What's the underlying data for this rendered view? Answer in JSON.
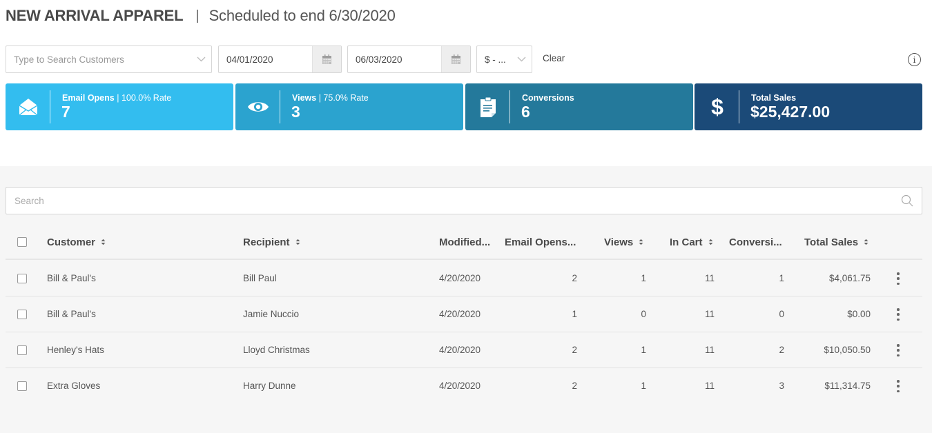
{
  "header": {
    "title": "NEW ARRIVAL APPAREL",
    "separator": "|",
    "subtitle": "Scheduled to end 6/30/2020"
  },
  "filters": {
    "customer_select": {
      "placeholder": "Type to Search Customers",
      "icon": "chevron-down-icon"
    },
    "start_date": {
      "value": "04/01/2020",
      "icon": "calendar-icon"
    },
    "end_date": {
      "value": "06/03/2020",
      "icon": "calendar-icon"
    },
    "currency_select": {
      "value": "$ - ...",
      "icon": "chevron-down-icon"
    },
    "clear_label": "Clear",
    "info_icon": "info-icon",
    "info_glyph": "i"
  },
  "cards": [
    {
      "name": "email-opens",
      "label": "Email Opens",
      "sep": " | ",
      "rate": "100.0% Rate",
      "value": "7",
      "icon": "envelope-open-icon",
      "color": "#33bdef"
    },
    {
      "name": "views",
      "label": "Views",
      "sep": " | ",
      "rate": "75.0% Rate",
      "value": "3",
      "icon": "eye-icon",
      "color": "#2ba3cf"
    },
    {
      "name": "conversions",
      "label": "Conversions",
      "sep": "",
      "rate": "",
      "value": "6",
      "icon": "clipboard-icon",
      "color": "#24799b"
    },
    {
      "name": "total-sales",
      "label": "Total Sales",
      "sep": "",
      "rate": "",
      "value": "$25,427.00",
      "icon": "dollar-icon",
      "color": "#1b4a78"
    }
  ],
  "table": {
    "search_placeholder": "Search",
    "columns": [
      {
        "key": "customer",
        "label": "Customer",
        "sortable": true
      },
      {
        "key": "recipient",
        "label": "Recipient",
        "sortable": true
      },
      {
        "key": "modified",
        "label": "Modified...",
        "sortable": false
      },
      {
        "key": "email_opens",
        "label": "Email Opens...",
        "sortable": false
      },
      {
        "key": "views",
        "label": "Views",
        "sortable": true
      },
      {
        "key": "in_cart",
        "label": "In Cart",
        "sortable": true
      },
      {
        "key": "conversions",
        "label": "Conversi...",
        "sortable": false
      },
      {
        "key": "total_sales",
        "label": "Total Sales",
        "sortable": true
      }
    ],
    "rows": [
      {
        "customer": "Bill & Paul's",
        "recipient": "Bill Paul",
        "modified": "4/20/2020",
        "email_opens": "2",
        "views": "1",
        "in_cart": "11",
        "conversions": "1",
        "total_sales": "$4,061.75"
      },
      {
        "customer": "Bill & Paul's",
        "recipient": "Jamie Nuccio",
        "modified": "4/20/2020",
        "email_opens": "1",
        "views": "0",
        "in_cart": "11",
        "conversions": "0",
        "total_sales": "$0.00"
      },
      {
        "customer": "Henley's Hats",
        "recipient": "Lloyd Christmas",
        "modified": "4/20/2020",
        "email_opens": "2",
        "views": "1",
        "in_cart": "11",
        "conversions": "2",
        "total_sales": "$10,050.50"
      },
      {
        "customer": "Extra Gloves",
        "recipient": "Harry Dunne",
        "modified": "4/20/2020",
        "email_opens": "2",
        "views": "1",
        "in_cart": "11",
        "conversions": "3",
        "total_sales": "$11,314.75"
      }
    ]
  }
}
